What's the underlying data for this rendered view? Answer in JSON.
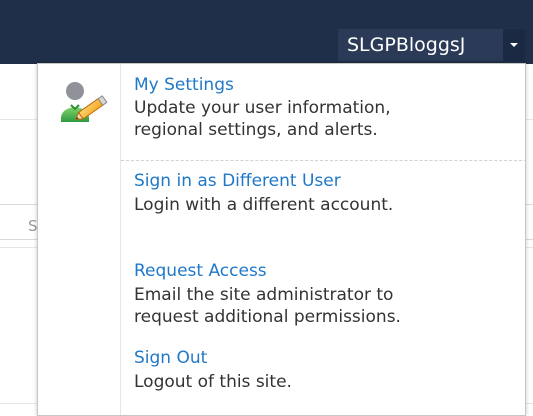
{
  "header": {
    "user_name": "SLGPBloggsJ"
  },
  "menu": {
    "items": [
      {
        "title": "My Settings",
        "description_lines": [
          "Update your user information,",
          "regional settings, and alerts."
        ]
      },
      {
        "title": "Sign in as Different User",
        "description_lines": [
          "Login with a different account."
        ]
      },
      {
        "title": "Request Access",
        "description_lines": [
          "Email the site administrator to",
          "request additional permissions."
        ]
      },
      {
        "title": "Sign Out",
        "description_lines": [
          "Logout of this site."
        ]
      }
    ]
  },
  "background": {
    "partial_field_text": "S"
  },
  "icons": {
    "settings_icon": "user-edit-icon",
    "dropdown_icon": "chevron-down-icon"
  },
  "colors": {
    "header_bg": "#1f2f49",
    "menu_link": "#1f78c8",
    "menu_text": "#333333"
  }
}
